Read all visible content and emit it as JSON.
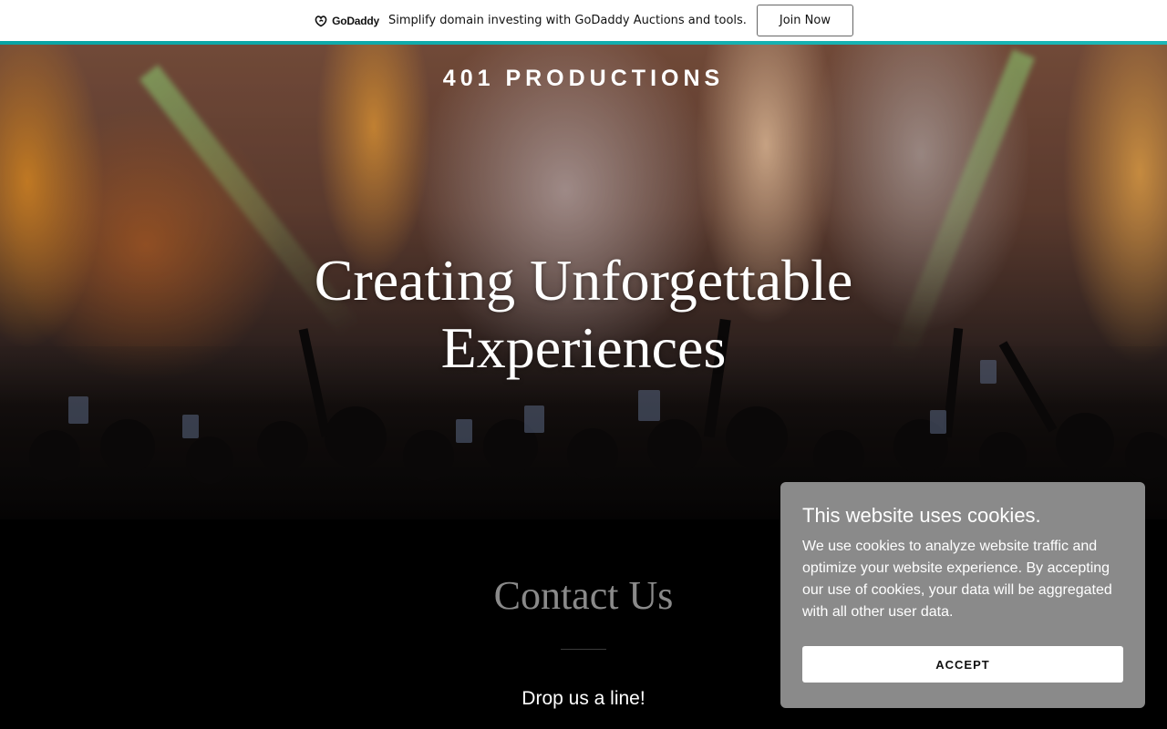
{
  "promo": {
    "logo_text": "GoDaddy",
    "message": "Simplify domain investing with GoDaddy Auctions and tools.",
    "join_label": "Join Now",
    "accent_color": "#09a4a4"
  },
  "hero": {
    "site_title": "401 PRODUCTIONS",
    "headline_line1": "Creating Unforgettable",
    "headline_line2": "Experiences"
  },
  "contact": {
    "title": "Contact Us",
    "subtitle": "Drop us a line!"
  },
  "cookie_banner": {
    "title": "This website uses cookies.",
    "body": "We use cookies to analyze website traffic and optimize your website experience. By accepting our use of cookies, your data will be aggregated with all other user data.",
    "accept_label": "ACCEPT",
    "background_color": "#8a8a8a"
  }
}
